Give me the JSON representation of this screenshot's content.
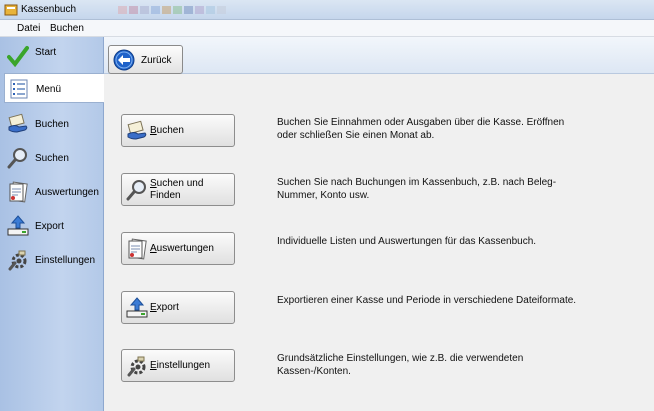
{
  "window": {
    "title": "Kassenbuch"
  },
  "menubar": {
    "items": [
      {
        "label": "Datei"
      },
      {
        "label": "Buchen"
      }
    ]
  },
  "sidebar": {
    "items": [
      {
        "label": "Start",
        "icon": "checkmark-icon"
      },
      {
        "label": "Menü",
        "icon": "list-icon"
      },
      {
        "label": "Buchen",
        "icon": "booking-hand-icon"
      },
      {
        "label": "Suchen",
        "icon": "magnifier-icon"
      },
      {
        "label": "Auswertungen",
        "icon": "report-icon"
      },
      {
        "label": "Export",
        "icon": "export-icon"
      },
      {
        "label": "Einstellungen",
        "icon": "settings-icon"
      }
    ]
  },
  "toolbar": {
    "back_label": "Zurück"
  },
  "actions": [
    {
      "label": "Buchen",
      "description": "Buchen Sie Einnahmen oder Ausgaben über die Kasse. Eröffnen oder schließen Sie einen Monat ab."
    },
    {
      "label": "Suchen und\nFinden",
      "description": "Suchen Sie nach Buchungen im Kassenbuch, z.B. nach Beleg-Nummer, Konto usw."
    },
    {
      "label": "Auswertungen",
      "description": "Individuelle Listen und Auswertungen für das Kassenbuch."
    },
    {
      "label": "Export",
      "description": "Exportieren einer Kasse und Periode in verschiedene Dateiformate."
    },
    {
      "label": "Einstellungen",
      "description": "Grundsätzliche Einstellungen, wie z.B. die verwendeten Kassen-/Konten."
    }
  ],
  "colors": {
    "accent": "#1f62c9",
    "sidebar": "#b6cbe9",
    "check": "#3aa52b"
  }
}
